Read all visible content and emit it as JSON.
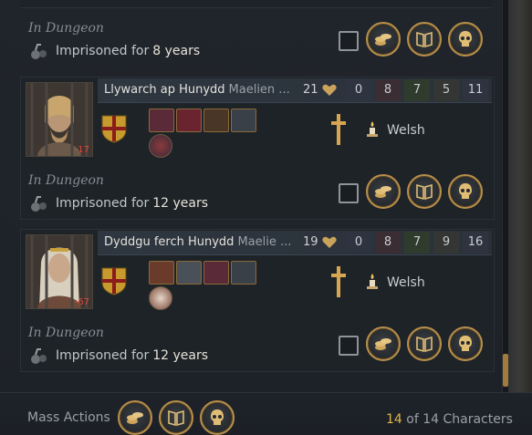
{
  "characters": [
    {
      "name": "Llywarch ap Hunydd",
      "dynasty": "Maelien ...",
      "opinion": "21",
      "age_modifier": "-17",
      "stats": [
        "0",
        "8",
        "7",
        "5",
        "11"
      ],
      "culture": "Welsh"
    },
    {
      "name": "Dyddgu ferch Hunydd",
      "dynasty": "Maelie ...",
      "opinion": "19",
      "age_modifier": "-67",
      "stats": [
        "0",
        "8",
        "7",
        "9",
        "16"
      ],
      "culture": "Welsh"
    }
  ],
  "dungeon_rows": [
    {
      "status": "In Dungeon",
      "imprisoned_label": "Imprisoned for",
      "years": "8 years"
    },
    {
      "status": "In Dungeon",
      "imprisoned_label": "Imprisoned for",
      "years": "12 years"
    },
    {
      "status": "In Dungeon",
      "imprisoned_label": "Imprisoned for",
      "years": "12 years"
    }
  ],
  "stat_colors": [
    "#2d3440",
    "#2d3a33",
    "#2f3b2d",
    "#3b2f2d",
    "#34303f"
  ],
  "footer": {
    "mass_actions_label": "Mass Actions",
    "count_current": "14",
    "count_rest": "of 14 Characters"
  },
  "icons": {
    "ransom": "coins-icon",
    "banish": "book-icon",
    "execute": "skull-icon",
    "imprisoned": "shackles-icon",
    "faith": "cross-icon",
    "culture": "candle-icon"
  },
  "accent": "#b78f4c"
}
